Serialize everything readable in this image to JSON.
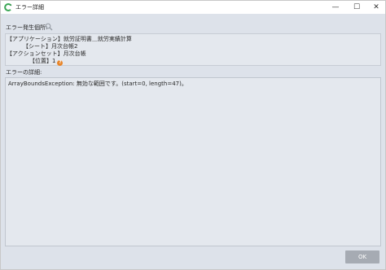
{
  "window": {
    "title": "エラー詳細",
    "controls": {
      "minimize": "—",
      "maximize": "☐",
      "close": "✕"
    }
  },
  "location": {
    "label": "エラー発生個所:",
    "lines": [
      "【アプリケーション】就労証明書＿就労実績計算",
      "【シート】月次台帳2",
      "【アクションセット】月次台帳",
      "【位置】1"
    ]
  },
  "error": {
    "label": "エラーの詳細:",
    "message": "ArrayBoundsException: 無効な範囲です。(start=0, length=47)。"
  },
  "footer": {
    "ok_label": "OK"
  },
  "colors": {
    "accent": "#e8852a",
    "app_icon": "#3aa655",
    "client_bg": "#dde2ea",
    "ok_bg": "#a6abb3"
  },
  "icons": {
    "app": "app-logo-icon",
    "search": "search-icon",
    "help": "help-icon"
  }
}
